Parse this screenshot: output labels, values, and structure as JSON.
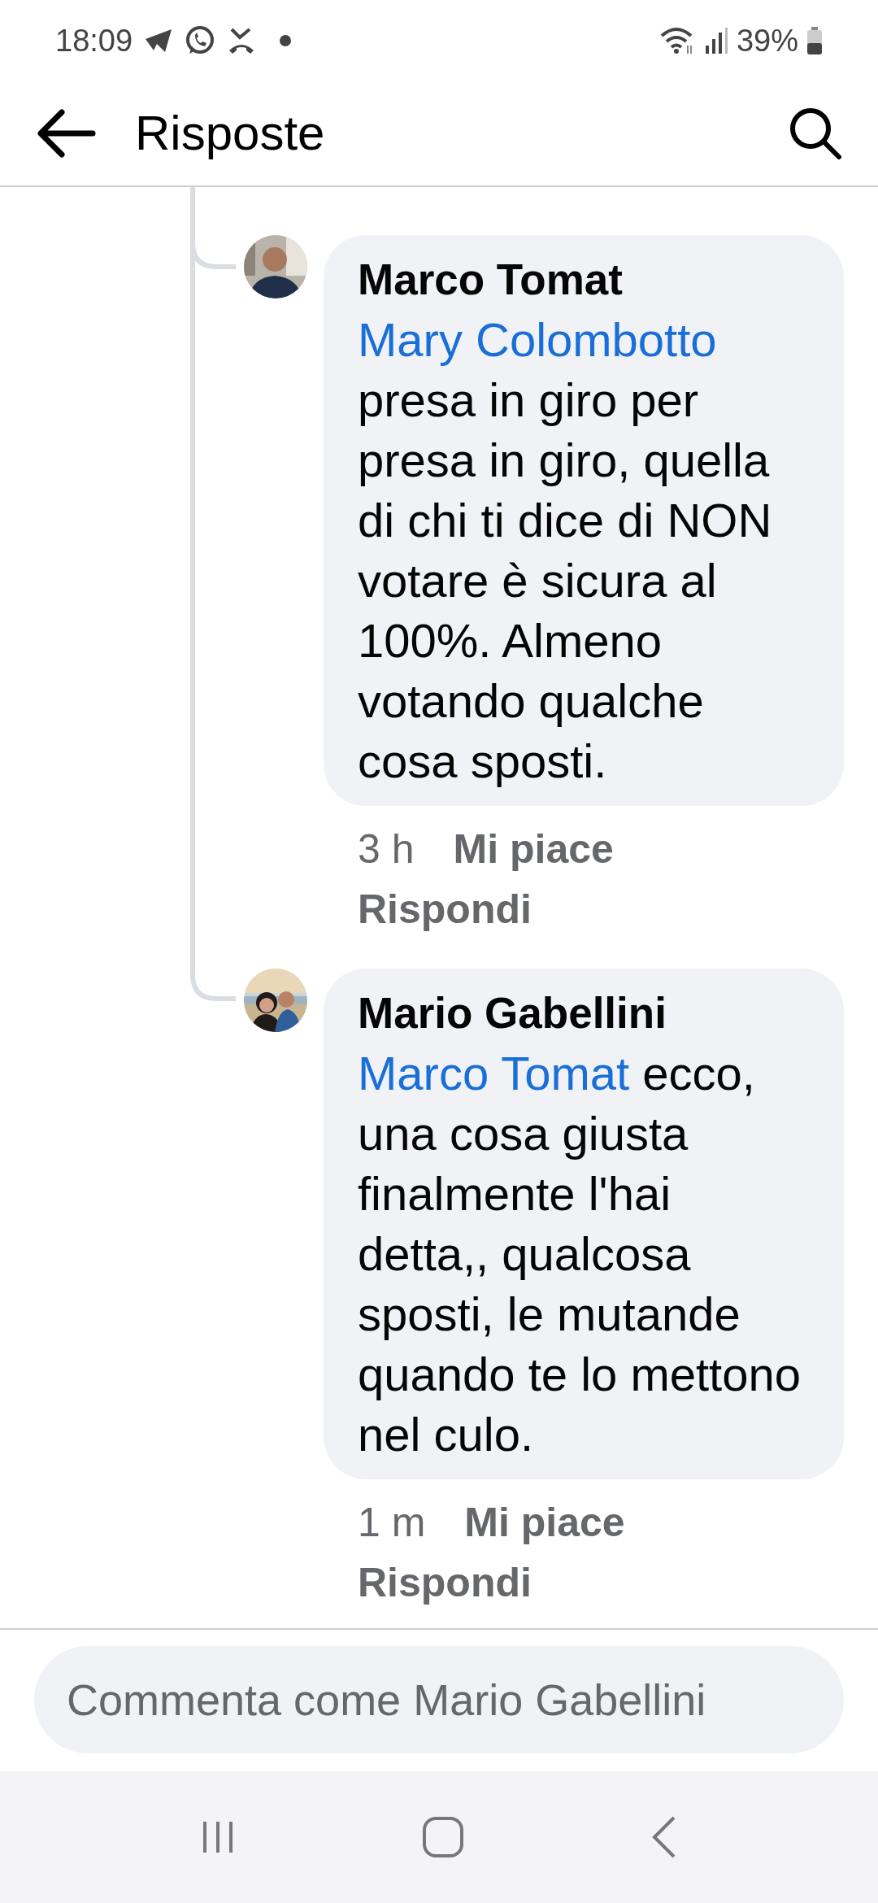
{
  "status_bar": {
    "time": "18:09",
    "battery": "39%"
  },
  "header": {
    "title": "Risposte"
  },
  "comments": [
    {
      "author": "Marco Tomat",
      "mention": "Mary Colombotto",
      "text": "presa in giro per presa in giro, quella di chi ti dice di NON votare è sicura al 100%. Almeno votando qualche cosa sposti.",
      "time": "3 h",
      "like": "Mi piace",
      "reply": "Rispondi"
    },
    {
      "author": "Mario Gabellini",
      "mention": "Marco Tomat",
      "text": "ecco, una cosa giusta finalmente l'hai detta,, qualcosa sposti, le mutande quando te lo mettono nel culo.",
      "time": "1 m",
      "like": "Mi piace",
      "reply": "Rispondi"
    }
  ],
  "composer": {
    "placeholder": "Commenta come Mario Gabellini"
  }
}
